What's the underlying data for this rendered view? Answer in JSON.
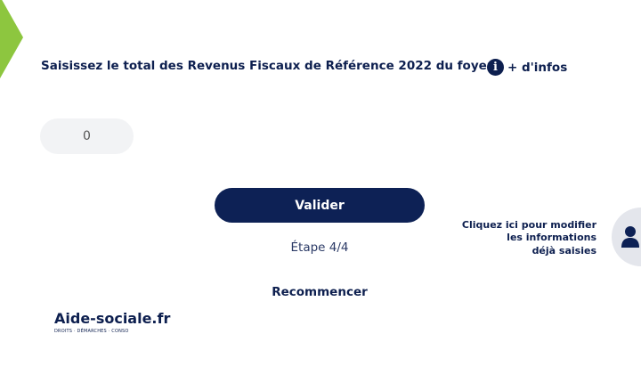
{
  "question": {
    "label": "Saisissez le total des Revenus Fiscaux de Référence 2022 du foyer",
    "info_label": "+ d'infos",
    "info_icon": "info-icon"
  },
  "amount_input": {
    "value": "0"
  },
  "validate_button": {
    "label": "Valider"
  },
  "step": {
    "label": "Étape 4/4"
  },
  "restart": {
    "label": "Recommencer"
  },
  "logo": {
    "name": "Aide-sociale.fr",
    "tagline": "DROITS · DÉMARCHES · CONSO"
  },
  "modify": {
    "line1": "Cliquez ici pour modifier",
    "line2": "les informations",
    "line3": "déjà saisies",
    "icon": "user-icon"
  },
  "colors": {
    "primary": "#0d2155",
    "accent_green": "#8dc63f",
    "input_bg": "#f2f3f5"
  }
}
